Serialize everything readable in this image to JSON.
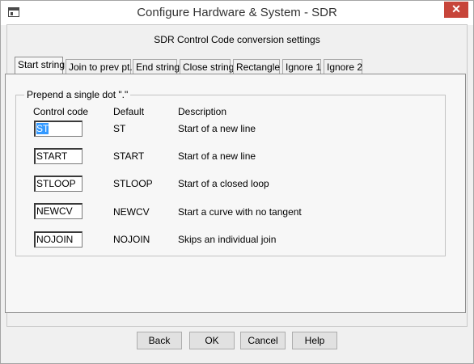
{
  "window": {
    "title": "Configure Hardware & System - SDR",
    "close_label": "✕"
  },
  "heading": "SDR Control Code conversion settings",
  "tabs": [
    {
      "label": "Start string",
      "active": true
    },
    {
      "label": "Join to prev pt."
    },
    {
      "label": "End string"
    },
    {
      "label": "Close string"
    },
    {
      "label": "Rectangle"
    },
    {
      "label": "Ignore 1"
    },
    {
      "label": "Ignore 2"
    }
  ],
  "group": {
    "label": "Prepend a single dot \".\"",
    "columns": {
      "control_code": "Control code",
      "default": "Default",
      "description": "Description"
    },
    "rows": [
      {
        "code": "ST",
        "default": "ST",
        "description": "Start of a new line",
        "selected": true
      },
      {
        "code": "START",
        "default": "START",
        "description": "Start of a new line"
      },
      {
        "code": "STLOOP",
        "default": "STLOOP",
        "description": "Start of a closed loop"
      },
      {
        "code": "NEWCV",
        "default": "NEWCV",
        "description": "Start a curve with no tangent"
      },
      {
        "code": "NOJOIN",
        "default": "NOJOIN",
        "description": "Skips an individual join"
      }
    ]
  },
  "buttons": {
    "back": "Back",
    "ok": "OK",
    "cancel": "Cancel",
    "help": "Help"
  }
}
